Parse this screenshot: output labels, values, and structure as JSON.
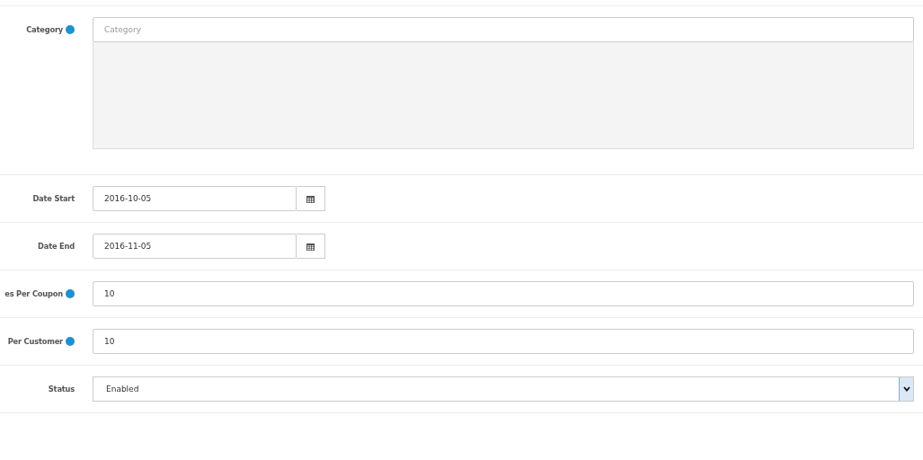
{
  "fields": [
    {
      "kind": "autocomplete",
      "label": "Category",
      "help": true,
      "placeholder": "Category"
    },
    {
      "kind": "date",
      "label": "Date Start",
      "help": false,
      "value": "2016-10-05"
    },
    {
      "kind": "date",
      "label": "Date End",
      "help": false,
      "value": "2016-11-05"
    },
    {
      "kind": "text",
      "label": "es Per Coupon",
      "help": true,
      "value": "10"
    },
    {
      "kind": "text",
      "label": "Per Customer",
      "help": true,
      "value": "10"
    },
    {
      "kind": "select",
      "label": "Status",
      "help": false,
      "value": "Enabled"
    }
  ]
}
